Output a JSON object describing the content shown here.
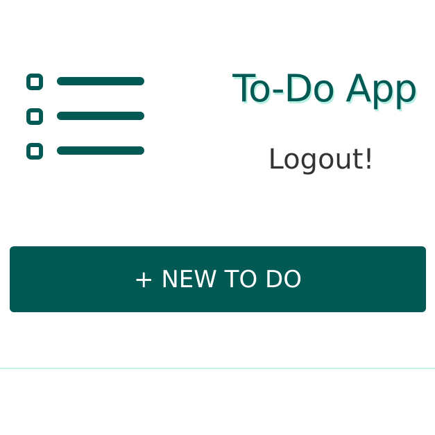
{
  "header": {
    "logo_icon": "checklist-icon",
    "title": "To-Do App",
    "logout_label": "Logout!"
  },
  "actions": {
    "new_todo_label": "+ NEW TO DO"
  },
  "colors": {
    "brand": "#035a55",
    "title_shadow": "#b6f0e2",
    "divider": "#c5f3e7",
    "text": "#333333",
    "background": "#ffffff"
  }
}
